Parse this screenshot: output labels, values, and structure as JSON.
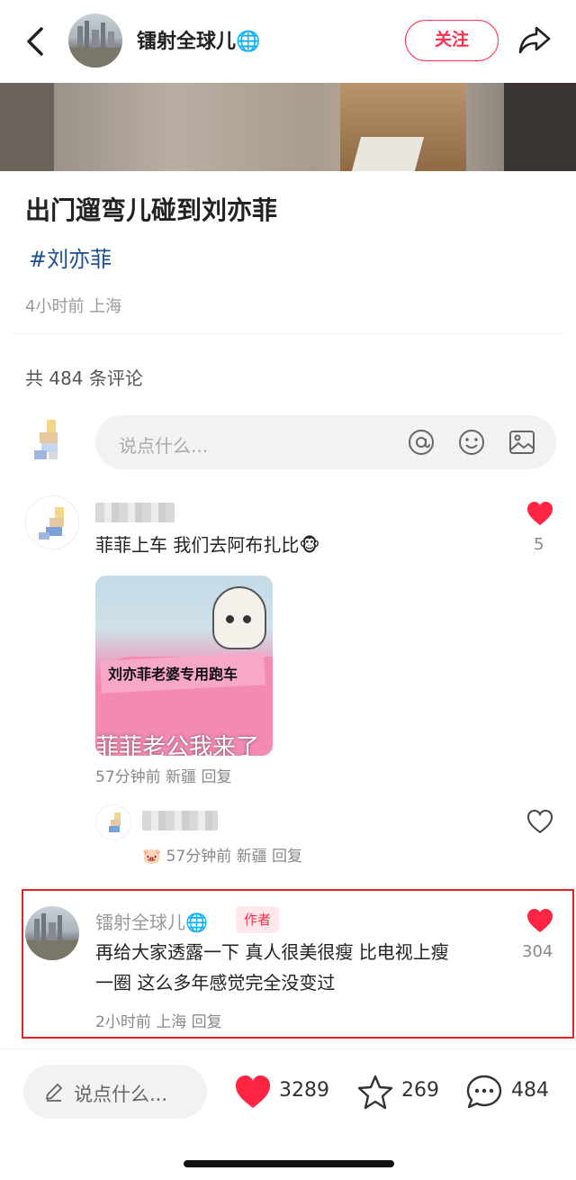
{
  "nav": {
    "author_name": "镭射全球儿🌐",
    "follow_label": "关注"
  },
  "post": {
    "title": "出门遛弯儿碰到刘亦菲",
    "tag": "#刘亦菲",
    "meta": "4小时前 上海"
  },
  "comments_header": {
    "count_text": "共 484 条评论",
    "input_placeholder": "说点什么..."
  },
  "comments": [
    {
      "text": "菲菲上车 我们去阿布扎比🐵",
      "likes": "5",
      "image_label": "刘亦菲老婆专用跑车",
      "image_caption": "菲菲老公我来了",
      "meta": "57分钟前 新疆 回复"
    },
    {
      "meta": "🐷 57分钟前 新疆 回复"
    },
    {
      "author": "镭射全球儿🌐",
      "badge": "作者",
      "text_line1": "再给大家透露一下 真人很美很瘦 比电视上瘦",
      "text_line2": "一圈 这么多年感觉完全没变过",
      "likes": "304",
      "meta": "2小时前 上海 回复"
    }
  ],
  "bottom_bar": {
    "input_placeholder": "说点什么...",
    "likes": "3289",
    "stars": "269",
    "comments": "484"
  },
  "colors": {
    "accent": "#ff2e4d",
    "tag": "#1b4f93",
    "highlight_border": "#e52222"
  }
}
